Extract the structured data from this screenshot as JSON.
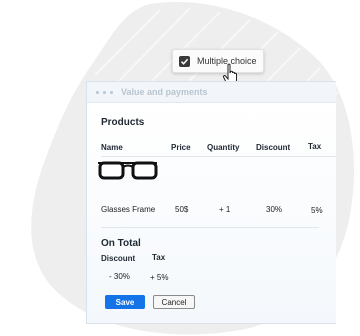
{
  "chip": {
    "label": "Multiple choice",
    "checked": true
  },
  "window": {
    "title": "Value and payments"
  },
  "products": {
    "heading": "Products",
    "columns": {
      "name": "Name",
      "price": "Price",
      "quantity": "Quantity",
      "discount": "Discount",
      "tax": "Tax"
    },
    "row": {
      "name": "Glasses Frame",
      "price": "50$",
      "quantity": "+ 1",
      "discount": "30%",
      "tax": "5%",
      "image_icon": "glasses-icon"
    }
  },
  "on_total": {
    "heading": "On Total",
    "columns": {
      "discount": "Discount",
      "tax": "Tax"
    },
    "values": {
      "discount": "- 30%",
      "tax": "+ 5%"
    }
  },
  "buttons": {
    "save": "Save",
    "cancel": "Cancel"
  },
  "colors": {
    "accent": "#1473e6",
    "blob": "#eeeeee"
  }
}
